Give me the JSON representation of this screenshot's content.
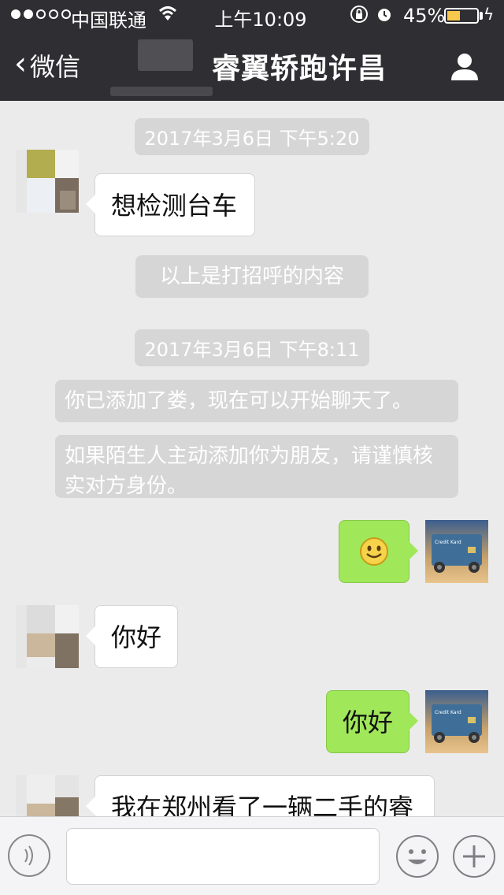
{
  "status_bar": {
    "carrier": "中国联通",
    "time": "上午10:09",
    "battery": "45%",
    "battery_level": 0.45
  },
  "nav": {
    "back_label": "微信",
    "title": "睿翼轿跑许昌"
  },
  "messages": {
    "timestamp1": "2017年3月6日 下午5:20",
    "msg1": "想检测台车",
    "system_greeting": "以上是打招呼的内容",
    "timestamp2": "2017年3月6日 下午8:11",
    "system_added": "你已添加了娄，现在可以开始聊天了。",
    "system_warning": "如果陌生人主动添加你为朋友，请谨慎核实对方身份。",
    "msg_hello_in": "你好",
    "msg_hello_out": "你好",
    "msg_last": "我在郑州看了一辆二手的睿",
    "avatar_card_text": "Credit Kard"
  },
  "colors": {
    "nav_bg": "#2f2f33",
    "chat_bg": "#ebebeb",
    "bubble_out": "#a0e75a",
    "bubble_in": "#ffffff",
    "system_bg": "#d6d6d6"
  }
}
